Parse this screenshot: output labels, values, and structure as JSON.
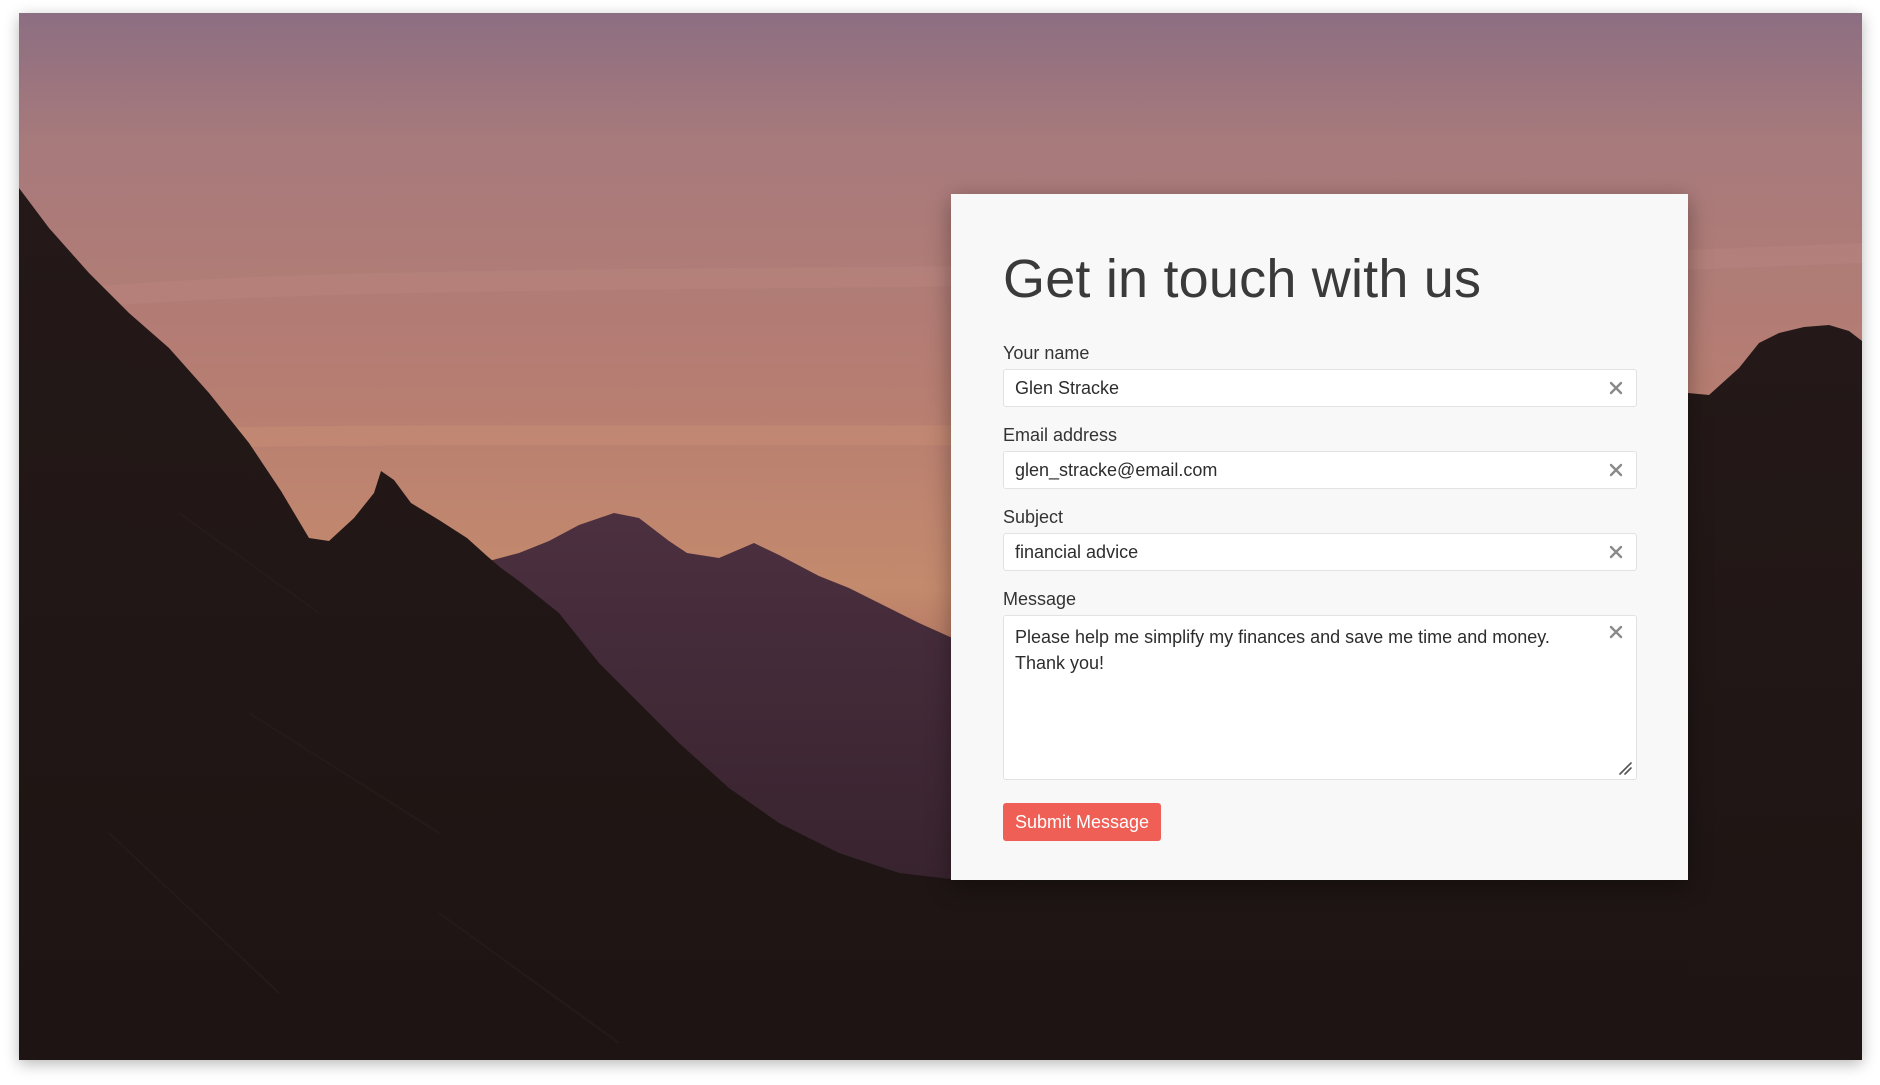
{
  "form": {
    "title": "Get in touch with us",
    "fields": {
      "name": {
        "label": "Your name",
        "value": "Glen Stracke"
      },
      "email": {
        "label": "Email address",
        "value": "glen_stracke@email.com"
      },
      "subject": {
        "label": "Subject",
        "value": "financial advice"
      },
      "message": {
        "label": "Message",
        "value": "Please help me simplify my finances and save me time and money.\nThank you!"
      }
    },
    "submit_label": "Submit Message"
  },
  "icons": {
    "clear": "close-icon",
    "resize": "resize-handle-icon"
  },
  "colors": {
    "accent": "#ef5f55",
    "card_background": "#f8f8f8",
    "title_text": "#3a3a3a",
    "sky_top": "#8c6e82",
    "sky_horizon": "#c98d6d",
    "mountain_dark": "#1e1514",
    "mountain_mid": "#3e2530"
  }
}
